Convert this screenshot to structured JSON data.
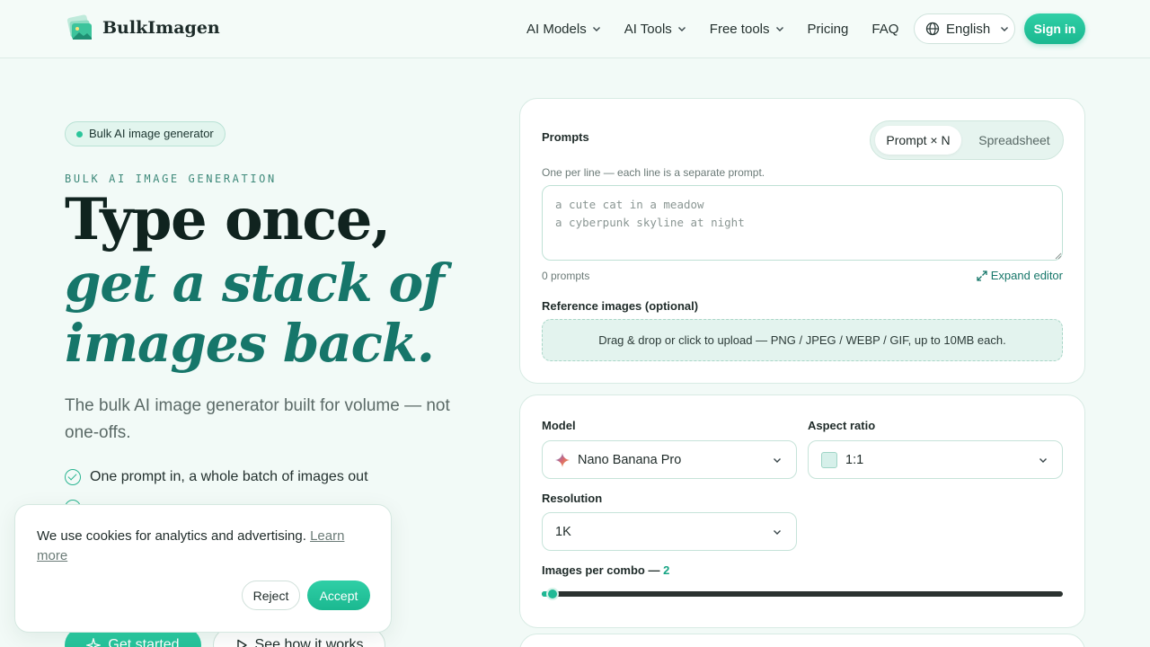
{
  "brand": {
    "name": "BulkImagen"
  },
  "nav": {
    "items": [
      {
        "label": "AI Models",
        "dropdown": true
      },
      {
        "label": "AI Tools",
        "dropdown": true
      },
      {
        "label": "Free tools",
        "dropdown": true
      },
      {
        "label": "Pricing",
        "dropdown": false
      },
      {
        "label": "FAQ",
        "dropdown": false
      }
    ],
    "language": "English",
    "signin": "Sign in"
  },
  "hero": {
    "badge": "Bulk AI image generator",
    "eyebrow": "BULK AI IMAGE GENERATION",
    "title_line1": "Type once,",
    "title_line2": "get a stack of",
    "title_line3": "images back.",
    "subtitle": "The bulk AI image generator built for volume — not one-offs.",
    "features": [
      "One prompt in, a whole batch of images out"
    ],
    "cta_primary": "Get started",
    "cta_secondary": "See how it works"
  },
  "cookie": {
    "text": "We use cookies for analytics and advertising.",
    "link": "Learn more",
    "reject": "Reject",
    "accept": "Accept"
  },
  "prompts_card": {
    "label": "Prompts",
    "tab_active": "Prompt × N",
    "tab_inactive": "Spreadsheet",
    "hint": "One per line — each line is a separate prompt.",
    "placeholder": "a cute cat in a meadow\na cyberpunk skyline at night",
    "count": "0 prompts",
    "expand": "Expand editor",
    "ref_label": "Reference images (optional)",
    "dropzone": "Drag & drop or click to upload — PNG / JPEG / WEBP / GIF, up to 10MB each."
  },
  "settings_card": {
    "model_label": "Model",
    "model_value": "Nano Banana Pro",
    "aspect_label": "Aspect ratio",
    "aspect_value": "1:1",
    "resolution_label": "Resolution",
    "resolution_value": "1K",
    "images_label": "Images per combo —",
    "images_value": "2",
    "images_fraction": 0.0
  },
  "colors": {
    "accent": "#1fb995",
    "brand_dark": "#16766a"
  }
}
